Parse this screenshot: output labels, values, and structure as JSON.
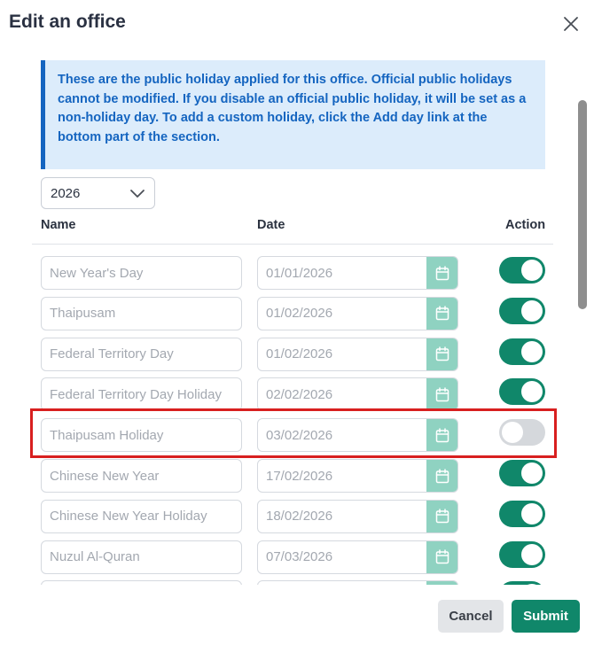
{
  "dialog": {
    "title": "Edit an office",
    "close_icon": "close-icon"
  },
  "info": {
    "text": "These are the public holiday applied for this office. Official public holidays cannot be modified. If you disable an official public holiday, it will be set as a non-holiday day. To add a custom holiday, click the Add day link at the bottom part of the section.",
    "accent_color": "#1565c0",
    "background_color": "#dcecfb"
  },
  "year_select": {
    "value": "2026",
    "icon": "chevron-down-icon"
  },
  "table": {
    "headers": {
      "name": "Name",
      "date": "Date",
      "action": "Action"
    },
    "rows": [
      {
        "name": "New Year's Day",
        "date": "01/01/2026",
        "enabled": true
      },
      {
        "name": "Thaipusam",
        "date": "01/02/2026",
        "enabled": true
      },
      {
        "name": "Federal Territory Day",
        "date": "01/02/2026",
        "enabled": true
      },
      {
        "name": "Federal Territory Day Holiday",
        "date": "02/02/2026",
        "enabled": true
      },
      {
        "name": "Thaipusam Holiday",
        "date": "03/02/2026",
        "enabled": false
      },
      {
        "name": "Chinese New Year",
        "date": "17/02/2026",
        "enabled": true
      },
      {
        "name": "Chinese New Year Holiday",
        "date": "18/02/2026",
        "enabled": true
      },
      {
        "name": "Nuzul Al-Quran",
        "date": "07/03/2026",
        "enabled": true
      },
      {
        "name": "",
        "date": "",
        "enabled": true
      }
    ]
  },
  "footer": {
    "cancel_label": "Cancel",
    "submit_label": "Submit"
  },
  "colors": {
    "primary": "#10876a",
    "calendar_button": "#8fd2c1",
    "toggle_off": "#d5d8dc",
    "highlight": "#d81f1f"
  }
}
